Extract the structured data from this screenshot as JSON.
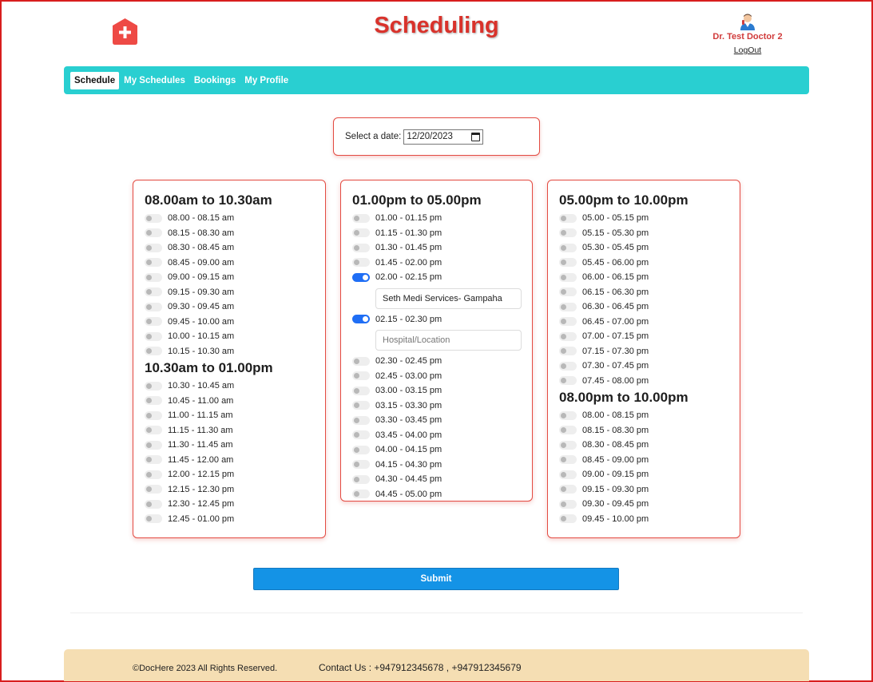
{
  "header": {
    "logo_icon": "medical-cross-icon",
    "title": "Scheduling",
    "user_name": "Dr. Test Doctor 2",
    "logout_label": "LogOut",
    "avatar_icon": "doctor-avatar-icon"
  },
  "nav": {
    "items": [
      {
        "label": "Schedule",
        "active": true
      },
      {
        "label": "My Schedules",
        "active": false
      },
      {
        "label": "Bookings",
        "active": false
      },
      {
        "label": "My Profile",
        "active": false
      }
    ]
  },
  "date_picker": {
    "label": "Select a date:",
    "value": "12/20/2023",
    "icon": "calendar-icon"
  },
  "columns": [
    {
      "groups": [
        {
          "title": "08.00am to 10.30am",
          "slots": [
            {
              "label": "08.00 - 08.15 am",
              "on": false
            },
            {
              "label": "08.15 - 08.30 am",
              "on": false
            },
            {
              "label": "08.30 - 08.45 am",
              "on": false
            },
            {
              "label": "08.45 - 09.00 am",
              "on": false
            },
            {
              "label": "09.00 - 09.15 am",
              "on": false
            },
            {
              "label": "09.15 - 09.30 am",
              "on": false
            },
            {
              "label": "09.30 - 09.45 am",
              "on": false
            },
            {
              "label": "09.45 - 10.00 am",
              "on": false
            },
            {
              "label": "10.00 - 10.15 am",
              "on": false
            },
            {
              "label": "10.15 - 10.30 am",
              "on": false
            }
          ]
        },
        {
          "title": "10.30am to 01.00pm",
          "slots": [
            {
              "label": "10.30 - 10.45 am",
              "on": false
            },
            {
              "label": "10.45 - 11.00 am",
              "on": false
            },
            {
              "label": "11.00 - 11.15 am",
              "on": false
            },
            {
              "label": "11.15 - 11.30 am",
              "on": false
            },
            {
              "label": "11.30 - 11.45 am",
              "on": false
            },
            {
              "label": "11.45 - 12.00 am",
              "on": false
            },
            {
              "label": "12.00 - 12.15 pm",
              "on": false
            },
            {
              "label": "12.15 - 12.30 pm",
              "on": false
            },
            {
              "label": "12.30 - 12.45 pm",
              "on": false
            },
            {
              "label": "12.45 - 01.00 pm",
              "on": false
            }
          ]
        }
      ]
    },
    {
      "groups": [
        {
          "title": "01.00pm to 05.00pm",
          "slots": [
            {
              "label": "01.00 - 01.15 pm",
              "on": false
            },
            {
              "label": "01.15 - 01.30 pm",
              "on": false
            },
            {
              "label": "01.30 - 01.45 pm",
              "on": false
            },
            {
              "label": "01.45 - 02.00 pm",
              "on": false
            },
            {
              "label": "02.00 - 02.15 pm",
              "on": true,
              "location_value": "Seth Medi Services- Gampaha",
              "location_placeholder": ""
            },
            {
              "label": "02.15 - 02.30 pm",
              "on": true,
              "location_value": "",
              "location_placeholder": "Hospital/Location"
            },
            {
              "label": "02.30 - 02.45 pm",
              "on": false
            },
            {
              "label": "02.45 - 03.00 pm",
              "on": false
            },
            {
              "label": "03.00 - 03.15 pm",
              "on": false
            },
            {
              "label": "03.15 - 03.30 pm",
              "on": false
            },
            {
              "label": "03.30 - 03.45 pm",
              "on": false
            },
            {
              "label": "03.45 - 04.00 pm",
              "on": false
            },
            {
              "label": "04.00 - 04.15 pm",
              "on": false
            },
            {
              "label": "04.15 - 04.30 pm",
              "on": false
            },
            {
              "label": "04.30 - 04.45 pm",
              "on": false
            },
            {
              "label": "04.45 - 05.00 pm",
              "on": false
            }
          ]
        }
      ]
    },
    {
      "groups": [
        {
          "title": "05.00pm to 10.00pm",
          "slots": [
            {
              "label": "05.00 - 05.15 pm",
              "on": false
            },
            {
              "label": "05.15 - 05.30 pm",
              "on": false
            },
            {
              "label": "05.30 - 05.45 pm",
              "on": false
            },
            {
              "label": "05.45 - 06.00 pm",
              "on": false
            },
            {
              "label": "06.00 - 06.15 pm",
              "on": false
            },
            {
              "label": "06.15 - 06.30 pm",
              "on": false
            },
            {
              "label": "06.30 - 06.45 pm",
              "on": false
            },
            {
              "label": "06.45 - 07.00 pm",
              "on": false
            },
            {
              "label": "07.00 - 07.15 pm",
              "on": false
            },
            {
              "label": "07.15 - 07.30 pm",
              "on": false
            },
            {
              "label": "07.30 - 07.45 pm",
              "on": false
            },
            {
              "label": "07.45 - 08.00 pm",
              "on": false
            }
          ]
        },
        {
          "title": "08.00pm to 10.00pm",
          "slots": [
            {
              "label": "08.00 - 08.15 pm",
              "on": false
            },
            {
              "label": "08.15 - 08.30 pm",
              "on": false
            },
            {
              "label": "08.30 - 08.45 pm",
              "on": false
            },
            {
              "label": "08.45 - 09.00 pm",
              "on": false
            },
            {
              "label": "09.00 - 09.15 pm",
              "on": false
            },
            {
              "label": "09.15 - 09.30 pm",
              "on": false
            },
            {
              "label": "09.30 - 09.45 pm",
              "on": false
            },
            {
              "label": "09.45 - 10.00 pm",
              "on": false
            }
          ]
        }
      ]
    }
  ],
  "submit_label": "Submit",
  "footer": {
    "copyright": "©DocHere 2023 All Rights Reserved.",
    "contact": "Contact Us : +947912345678 , +947912345679"
  },
  "colors": {
    "title": "#d9322b",
    "navbar": "#29cfd1",
    "card_border": "#e34b42",
    "toggle_on": "#1f6ef5",
    "submit": "#1493e6",
    "footer": "#f5deb3"
  }
}
